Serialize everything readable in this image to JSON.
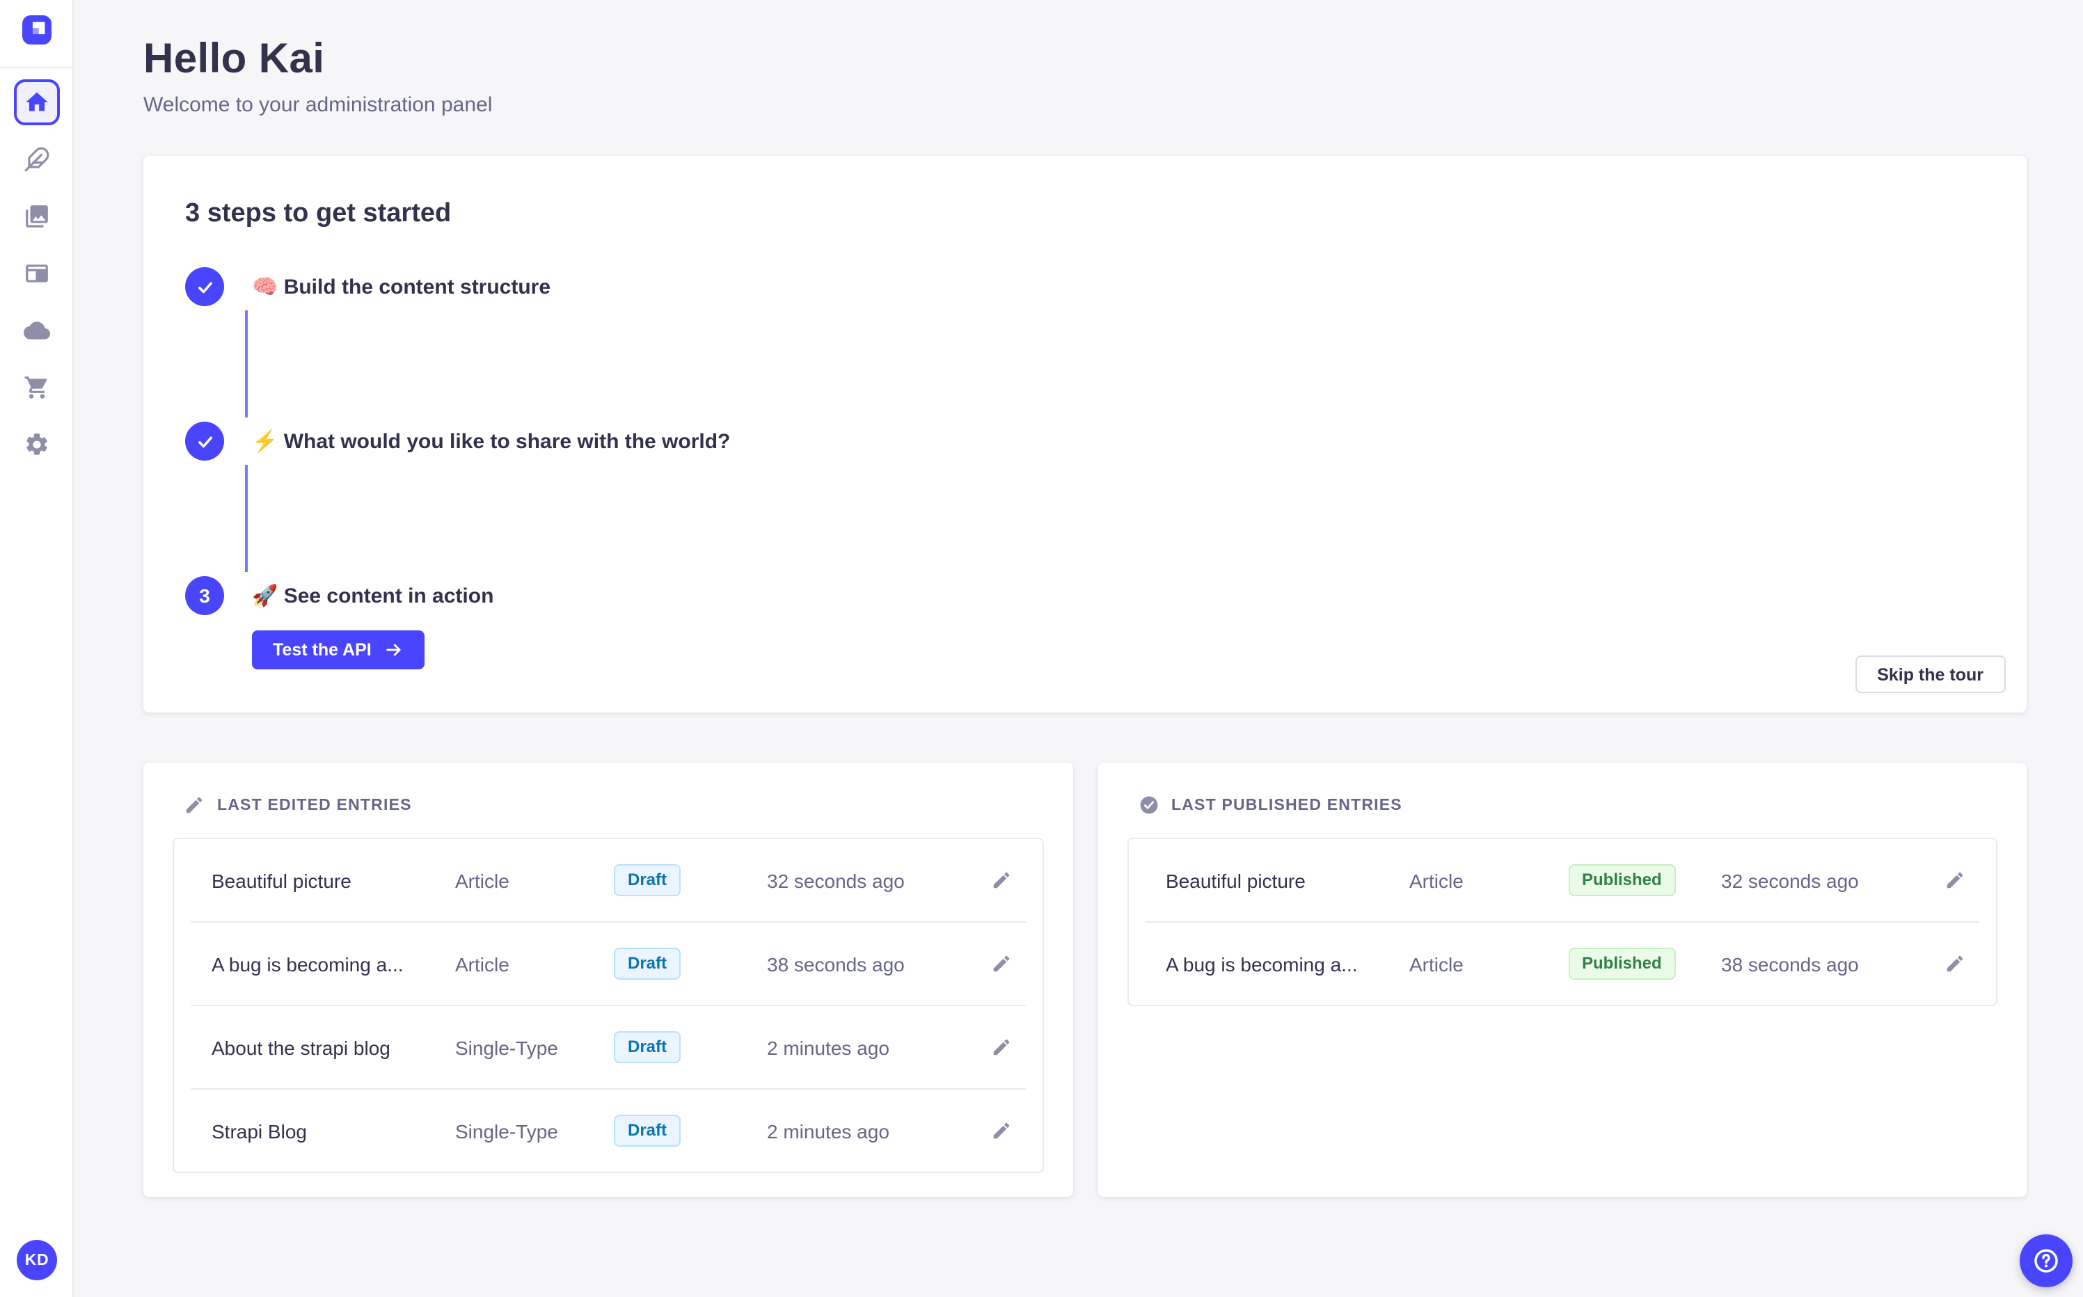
{
  "colors": {
    "primary": "#4945FF",
    "primary_light": "#F0F0FF",
    "connector": "#7B79FF",
    "background": "#F6F6F9",
    "text_dark": "#32324D",
    "text_muted": "#666687",
    "icon_gray": "#8E8EA9",
    "draft_bg": "#EAF5FF",
    "draft_border": "#B8E1FF",
    "draft_text": "#0C75AF",
    "published_bg": "#EAFBE7",
    "published_border": "#C6F0C2",
    "published_text": "#328048"
  },
  "sidebar": {
    "logo_icon": "strapi-logo",
    "items": [
      {
        "id": "home",
        "icon": "home-icon",
        "active": true
      },
      {
        "id": "content-manager",
        "icon": "feather-icon",
        "active": false
      },
      {
        "id": "media-library",
        "icon": "images-icon",
        "active": false
      },
      {
        "id": "content-type-builder",
        "icon": "layout-icon",
        "active": false
      },
      {
        "id": "deploy",
        "icon": "cloud-icon",
        "active": false
      },
      {
        "id": "marketplace",
        "icon": "cart-icon",
        "active": false
      },
      {
        "id": "settings",
        "icon": "gear-icon",
        "active": false
      }
    ],
    "avatar_initials": "KD"
  },
  "header": {
    "title": "Hello Kai",
    "subtitle": "Welcome to your administration panel"
  },
  "onboarding": {
    "title": "3 steps to get started",
    "steps": [
      {
        "number": 1,
        "done": true,
        "label": "🧠 Build the content structure"
      },
      {
        "number": 2,
        "done": true,
        "label": "⚡ What would you like to share with the world?"
      },
      {
        "number": 3,
        "done": false,
        "label": "🚀 See content in action"
      }
    ],
    "cta_label": "Test the API",
    "skip_label": "Skip the tour"
  },
  "panels": {
    "edited": {
      "title": "LAST EDITED ENTRIES",
      "icon": "pencil-icon",
      "rows": [
        {
          "title": "Beautiful picture",
          "type": "Article",
          "status": "Draft",
          "time": "32 seconds ago"
        },
        {
          "title": "A bug is becoming a...",
          "type": "Article",
          "status": "Draft",
          "time": "38 seconds ago"
        },
        {
          "title": "About the strapi blog",
          "type": "Single-Type",
          "status": "Draft",
          "time": "2 minutes ago"
        },
        {
          "title": "Strapi Blog",
          "type": "Single-Type",
          "status": "Draft",
          "time": "2 minutes ago"
        }
      ]
    },
    "published": {
      "title": "LAST PUBLISHED ENTRIES",
      "icon": "check-circle-icon",
      "rows": [
        {
          "title": "Beautiful picture",
          "type": "Article",
          "status": "Published",
          "time": "32 seconds ago"
        },
        {
          "title": "A bug is becoming a...",
          "type": "Article",
          "status": "Published",
          "time": "38 seconds ago"
        }
      ]
    }
  }
}
